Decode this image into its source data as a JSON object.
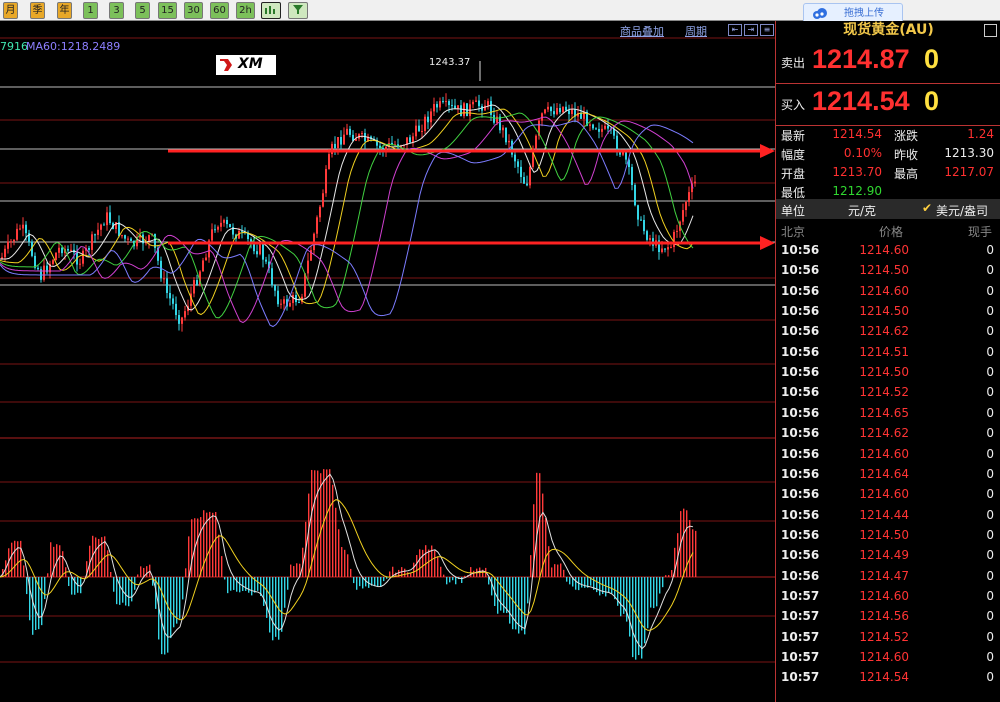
{
  "toolbar": {
    "periods": [
      "月",
      "季",
      "年"
    ],
    "minutes": [
      "1",
      "3",
      "5",
      "15",
      "30",
      "60",
      "2h"
    ],
    "icons": [
      "chart-icon",
      "filter-icon"
    ]
  },
  "upload_widget": {
    "label": "拖拽上传"
  },
  "chart": {
    "links": {
      "overlay": "商品叠加",
      "period": "周期"
    },
    "ma_labels": {
      "partial": "7916",
      "ma60": "MA60:1218.2489"
    },
    "logo_text": "XM",
    "peak_label": "1243.37",
    "colors": {
      "up": "#ff3a3a",
      "down": "#33d6e6",
      "arrow": "#ff2222",
      "grid": "#7a1515",
      "hline": "#bbbbbb"
    }
  },
  "quote_panel": {
    "title": "现货黄金(AU)",
    "sell": {
      "label": "卖出",
      "price": "1214.87",
      "volume": "0"
    },
    "buy": {
      "label": "买入",
      "price": "1214.54",
      "volume": "0"
    },
    "stats": [
      {
        "label": "最新",
        "value": "1214.54",
        "color": "#ff3030",
        "label2": "涨跌",
        "value2": "1.24",
        "color2": "#ff3030"
      },
      {
        "label": "幅度",
        "value": "0.10%",
        "color": "#ff3030",
        "label2": "昨收",
        "value2": "1213.30",
        "color2": "#eeeeee"
      },
      {
        "label": "开盘",
        "value": "1213.70",
        "color": "#ff3030",
        "label2": "最高",
        "value2": "1217.07",
        "color2": "#ff3030"
      },
      {
        "label": "最低",
        "value": "1212.90",
        "color": "#30d830",
        "label2": "",
        "value2": "",
        "color2": "#eeeeee"
      }
    ],
    "unit": {
      "label": "单位",
      "value": "元/克",
      "alt": "美元/盎司"
    },
    "tick_header": {
      "time": "北京",
      "price": "价格",
      "volume": "现手"
    },
    "ticks": [
      {
        "time": "10:56",
        "price": "1214.60",
        "vol": "0"
      },
      {
        "time": "10:56",
        "price": "1214.50",
        "vol": "0"
      },
      {
        "time": "10:56",
        "price": "1214.60",
        "vol": "0"
      },
      {
        "time": "10:56",
        "price": "1214.50",
        "vol": "0"
      },
      {
        "time": "10:56",
        "price": "1214.62",
        "vol": "0"
      },
      {
        "time": "10:56",
        "price": "1214.51",
        "vol": "0"
      },
      {
        "time": "10:56",
        "price": "1214.50",
        "vol": "0"
      },
      {
        "time": "10:56",
        "price": "1214.52",
        "vol": "0"
      },
      {
        "time": "10:56",
        "price": "1214.65",
        "vol": "0"
      },
      {
        "time": "10:56",
        "price": "1214.62",
        "vol": "0"
      },
      {
        "time": "10:56",
        "price": "1214.60",
        "vol": "0"
      },
      {
        "time": "10:56",
        "price": "1214.64",
        "vol": "0"
      },
      {
        "time": "10:56",
        "price": "1214.60",
        "vol": "0"
      },
      {
        "time": "10:56",
        "price": "1214.44",
        "vol": "0"
      },
      {
        "time": "10:56",
        "price": "1214.50",
        "vol": "0"
      },
      {
        "time": "10:56",
        "price": "1214.49",
        "vol": "0"
      },
      {
        "time": "10:56",
        "price": "1214.47",
        "vol": "0"
      },
      {
        "time": "10:57",
        "price": "1214.60",
        "vol": "0"
      },
      {
        "time": "10:57",
        "price": "1214.56",
        "vol": "0"
      },
      {
        "time": "10:57",
        "price": "1214.52",
        "vol": "0"
      },
      {
        "time": "10:57",
        "price": "1214.60",
        "vol": "0"
      },
      {
        "time": "10:57",
        "price": "1214.54",
        "vol": "0"
      }
    ]
  }
}
